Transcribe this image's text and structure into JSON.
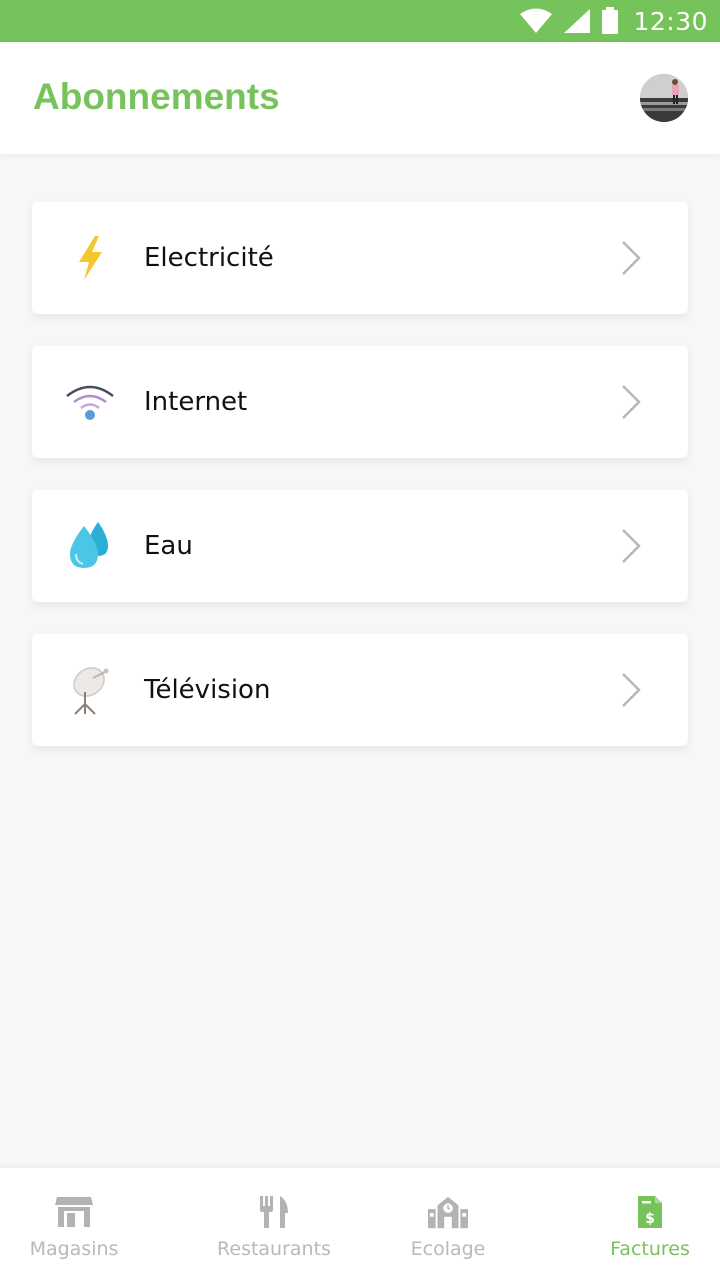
{
  "status_bar": {
    "time": "12:30",
    "icons": [
      "wifi-icon",
      "signal-icon",
      "battery-icon"
    ]
  },
  "header": {
    "title": "Abonnements",
    "avatar": "user-avatar"
  },
  "subscriptions": [
    {
      "label": "Electricité",
      "icon": "lightning-icon"
    },
    {
      "label": "Internet",
      "icon": "wifi-signal-icon"
    },
    {
      "label": "Eau",
      "icon": "water-drops-icon"
    },
    {
      "label": "Télévision",
      "icon": "satellite-dish-icon"
    }
  ],
  "bottom_nav": {
    "items": [
      {
        "label": "Magasins",
        "icon": "store-icon",
        "active": false
      },
      {
        "label": "Restaurants",
        "icon": "fork-knife-icon",
        "active": false
      },
      {
        "label": "Ecolage",
        "icon": "school-icon",
        "active": false
      },
      {
        "label": "Factures",
        "icon": "invoice-icon",
        "active": true
      }
    ]
  },
  "colors": {
    "accent": "#77c35b",
    "inactive": "#b9b9b9",
    "background": "#f7f8f6"
  }
}
